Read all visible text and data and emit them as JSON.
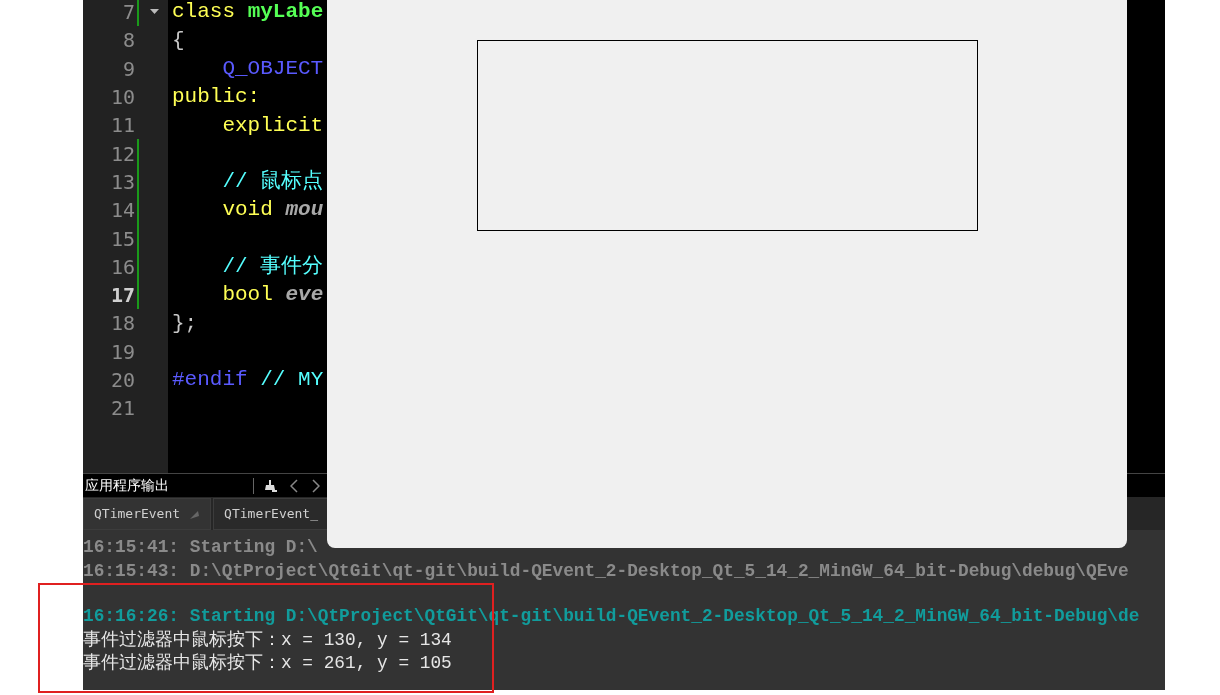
{
  "editor": {
    "lines": [
      {
        "number": "7",
        "current": false,
        "changed": true,
        "foldable": true,
        "tokens": [
          {
            "text": "class ",
            "kind": "keyword"
          },
          {
            "text": "myLabe",
            "kind": "type"
          }
        ]
      },
      {
        "number": "8",
        "current": false,
        "changed": false,
        "foldable": false,
        "tokens": [
          {
            "text": "{",
            "kind": "plain"
          }
        ]
      },
      {
        "number": "9",
        "current": false,
        "changed": false,
        "foldable": false,
        "tokens": [
          {
            "text": "    Q_OBJECT",
            "kind": "macro"
          }
        ]
      },
      {
        "number": "10",
        "current": false,
        "changed": false,
        "foldable": false,
        "tokens": [
          {
            "text": "public:",
            "kind": "keyword"
          }
        ]
      },
      {
        "number": "11",
        "current": false,
        "changed": false,
        "foldable": false,
        "tokens": [
          {
            "text": "    explicit",
            "kind": "keyword"
          }
        ]
      },
      {
        "number": "12",
        "current": false,
        "changed": true,
        "foldable": false
      },
      {
        "number": "13",
        "current": false,
        "changed": true,
        "foldable": false,
        "tokens": [
          {
            "text": "    // 鼠标点",
            "kind": "comment"
          }
        ]
      },
      {
        "number": "14",
        "current": false,
        "changed": true,
        "foldable": false,
        "tokens": [
          {
            "text": "    void ",
            "kind": "keyword"
          },
          {
            "text": "mou",
            "kind": "italic"
          }
        ]
      },
      {
        "number": "15",
        "current": false,
        "changed": true,
        "foldable": false
      },
      {
        "number": "16",
        "current": false,
        "changed": true,
        "foldable": false,
        "tokens": [
          {
            "text": "    // 事件分",
            "kind": "comment"
          }
        ]
      },
      {
        "number": "17",
        "current": true,
        "changed": true,
        "foldable": false,
        "tokens": [
          {
            "text": "    bool ",
            "kind": "keyword"
          },
          {
            "text": "eve",
            "kind": "italic"
          }
        ]
      },
      {
        "number": "18",
        "current": false,
        "changed": false,
        "foldable": false,
        "tokens": [
          {
            "text": "};",
            "kind": "plain"
          }
        ]
      },
      {
        "number": "19",
        "current": false,
        "changed": false,
        "foldable": false
      },
      {
        "number": "20",
        "current": false,
        "changed": false,
        "foldable": false,
        "tokens": [
          {
            "text": "#endif ",
            "kind": "macro"
          },
          {
            "text": "// MY",
            "kind": "comment"
          }
        ]
      },
      {
        "number": "21",
        "current": false,
        "changed": false,
        "foldable": false
      }
    ]
  },
  "output_pane": {
    "title": "应用程序输出",
    "tabs": [
      {
        "label": "QTimerEvent",
        "selected": true
      },
      {
        "label": "QTimerEvent_",
        "selected": false
      }
    ],
    "lines": [
      {
        "kind": "old",
        "text": "16:15:41: Starting D:\\"
      },
      {
        "kind": "old",
        "text": "16:15:43: D:\\QtProject\\QtGit\\qt-git\\build-QEvent_2-Desktop_Qt_5_14_2_MinGW_64_bit-Debug\\debug\\QEve"
      },
      {
        "kind": "blank"
      },
      {
        "kind": "start",
        "text": "16:16:26: Starting D:\\QtProject\\QtGit\\qt-git\\build-QEvent_2-Desktop_Qt_5_14_2_MinGW_64_bit-Debug\\de"
      },
      {
        "kind": "app",
        "text": "事件过滤器中鼠标按下：x = 130, y = 134"
      },
      {
        "kind": "app",
        "text": "事件过滤器中鼠标按下：x = 261, y = 105"
      }
    ]
  }
}
